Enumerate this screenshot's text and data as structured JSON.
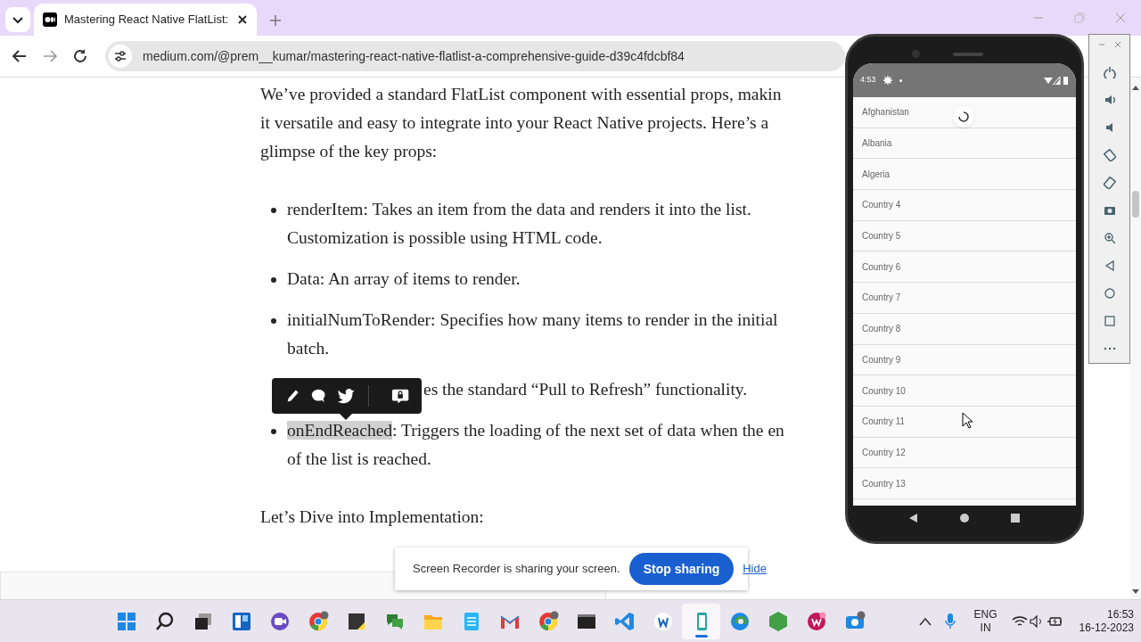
{
  "browser": {
    "tab": {
      "title": "Mastering React Native FlatList:",
      "selected": true
    },
    "address": "medium.com/@prem__kumar/mastering-react-native-flatlist-a-comprehensive-guide-d39c4fdcbf84"
  },
  "article": {
    "intro_lines": [
      "We’ve provided a standard FlatList component with essential props, makin",
      "it versatile and easy to integrate into your React Native projects. Here’s a",
      "glimpse of the key props:"
    ],
    "bullets": [
      {
        "kind": "normal",
        "lines": [
          "renderItem: Takes an item from the data and renders it into the list.",
          "Customization is possible using HTML code."
        ]
      },
      {
        "kind": "normal",
        "lines": [
          "Data: An array of items to render."
        ]
      },
      {
        "kind": "normal",
        "lines": [
          "initialNumToRender: Specifies how many items to render in the initial",
          "batch."
        ]
      },
      {
        "kind": "covered",
        "lines": [
          "es the standard “Pull to Refresh” functionality."
        ]
      },
      {
        "kind": "highlighted",
        "highlight": "onEndReached",
        "lines": [
          ": Triggers the loading of the next set of data when the en",
          "of the list is reached."
        ]
      }
    ],
    "heading": "Let’s Dive into Implementation:"
  },
  "emulator": {
    "status_time": "4:53",
    "loading": true,
    "items": [
      "Afghanistan",
      "Albania",
      "Algeria",
      "Country 4",
      "Country 5",
      "Country 6",
      "Country 7",
      "Country 8",
      "Country 9",
      "Country 10",
      "Country 11",
      "Country 12",
      "Country 13"
    ]
  },
  "share_bar": {
    "message": "Screen Recorder is sharing your screen.",
    "button": "Stop sharing",
    "link": "Hide"
  },
  "taskbar": {
    "apps": [
      {
        "kind": "start",
        "selected": false
      },
      {
        "kind": "search",
        "selected": false
      },
      {
        "kind": "taskview",
        "selected": false
      },
      {
        "kind": "widgets",
        "selected": false
      },
      {
        "kind": "meet",
        "selected": false
      },
      {
        "kind": "chrome",
        "selected": false
      },
      {
        "kind": "notes",
        "selected": false
      },
      {
        "kind": "chat",
        "selected": false
      },
      {
        "kind": "folder",
        "selected": false
      },
      {
        "kind": "notepad",
        "selected": false
      },
      {
        "kind": "mail",
        "selected": false
      },
      {
        "kind": "chrome",
        "selected": false
      },
      {
        "kind": "terminal",
        "selected": false
      },
      {
        "kind": "code",
        "selected": false
      },
      {
        "kind": "app",
        "selected": false
      },
      {
        "kind": "phone",
        "selected": true
      },
      {
        "kind": "edge",
        "selected": false
      },
      {
        "kind": "hexagon",
        "selected": false
      },
      {
        "kind": "heart",
        "selected": false
      },
      {
        "kind": "camera",
        "selected": false
      }
    ],
    "language": [
      "ENG",
      "IN"
    ],
    "time": "16:53",
    "date": "16-12-2023"
  }
}
